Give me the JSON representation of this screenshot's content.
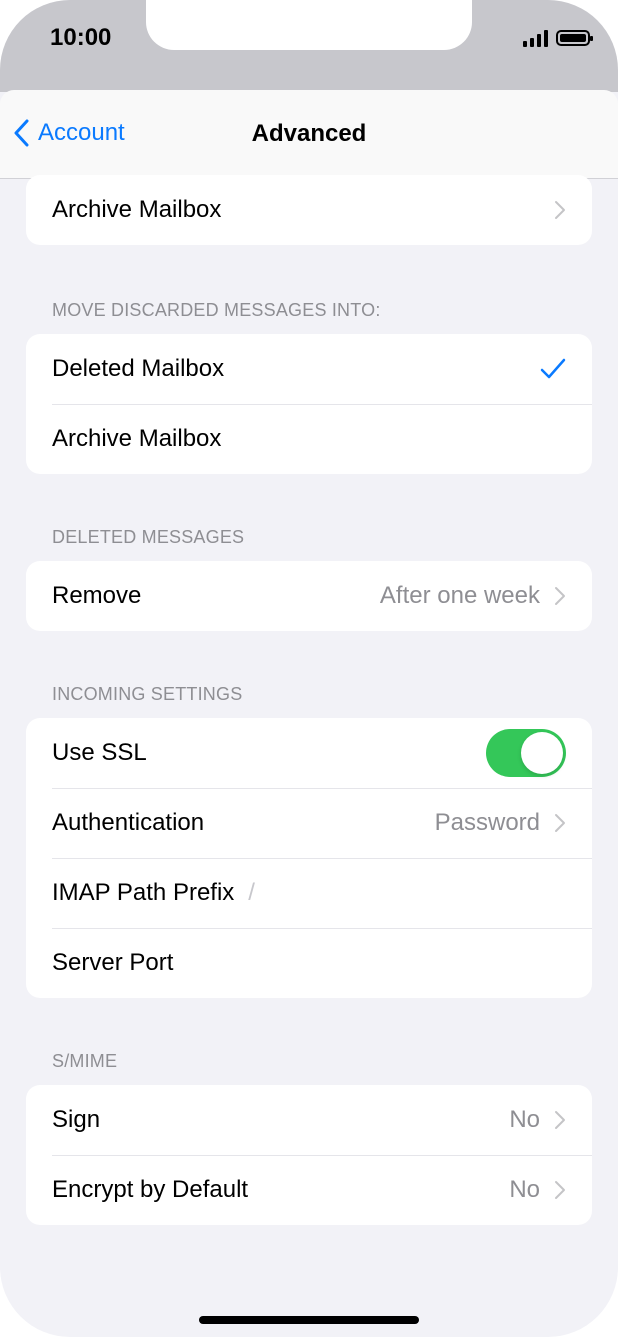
{
  "status_bar": {
    "time": "10:00"
  },
  "nav": {
    "back_label": "Account",
    "title": "Advanced"
  },
  "top_group": {
    "archive_label": "Archive Mailbox"
  },
  "discarded": {
    "header": "MOVE DISCARDED MESSAGES INTO:",
    "items": [
      {
        "label": "Deleted Mailbox",
        "selected": true
      },
      {
        "label": "Archive Mailbox",
        "selected": false
      }
    ]
  },
  "deleted_messages": {
    "header": "DELETED MESSAGES",
    "remove_label": "Remove",
    "remove_value": "After one week"
  },
  "incoming": {
    "header": "INCOMING SETTINGS",
    "ssl_label": "Use SSL",
    "ssl_on": true,
    "auth_label": "Authentication",
    "auth_value": "Password",
    "imap_label": "IMAP Path Prefix",
    "imap_value": "/",
    "port_label": "Server Port"
  },
  "smime": {
    "header": "S/MIME",
    "sign_label": "Sign",
    "sign_value": "No",
    "encrypt_label": "Encrypt by Default",
    "encrypt_value": "No"
  },
  "colors": {
    "accent": "#0a7aff",
    "toggle_on": "#34c759",
    "secondary_text": "#8e8e93"
  }
}
